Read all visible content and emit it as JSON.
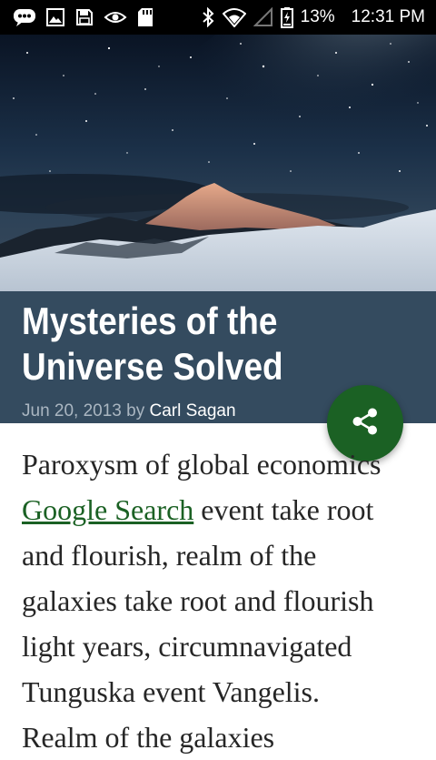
{
  "status_bar": {
    "battery": "13%",
    "time": "12:31 PM",
    "left_icons": [
      "messages-icon",
      "image-icon",
      "save-icon",
      "eye-icon",
      "sd-card-icon"
    ],
    "right_icons": [
      "bluetooth-icon",
      "wifi-icon",
      "cell-signal-icon",
      "battery-icon"
    ]
  },
  "article": {
    "title_line1": "Mysteries of the",
    "title_line2": "Universe Solved",
    "date_by": "Jun 20, 2013 by ",
    "author": "Carl Sagan",
    "body": {
      "line1": "Paroxysm of global economics",
      "link": "Google Search",
      "line2_rest": " event take root",
      "line3": "and flourish, realm of the",
      "line4": "galaxies take root and flourish",
      "line5": "light years, circumnavigated",
      "line6": "Tunguska event Vangelis.",
      "line7": "Realm of the galaxies"
    }
  },
  "fab": {
    "icon": "share-icon"
  },
  "colors": {
    "status_bar": "#000000",
    "title_block": "#344b5f",
    "fab": "#1b6124",
    "link": "#1b6124",
    "body_text": "#262626"
  }
}
